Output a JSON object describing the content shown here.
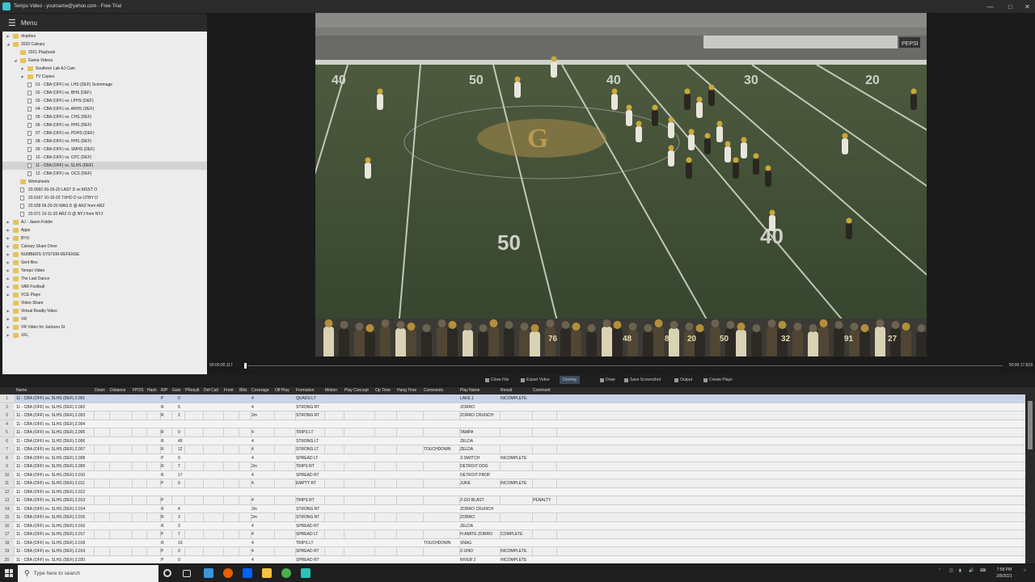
{
  "window": {
    "title": "Tempo Video - yourname@yahoo.com - Free Trial"
  },
  "menu": {
    "label": "Menu"
  },
  "tree": [
    {
      "label": "dropbox",
      "depth": 0,
      "icon": "folder",
      "arrow": "right"
    },
    {
      "label": "2020 Calvary",
      "depth": 0,
      "icon": "folder",
      "arrow": "down"
    },
    {
      "label": "2021 Playbook",
      "depth": 1,
      "icon": "folder",
      "arrow": ""
    },
    {
      "label": "Game Videos",
      "depth": 1,
      "icon": "folder",
      "arrow": "down"
    },
    {
      "label": "Southern Lab AJ Cam",
      "depth": 2,
      "icon": "folder",
      "arrow": "right"
    },
    {
      "label": "TV Copies",
      "depth": 2,
      "icon": "folder",
      "arrow": "right"
    },
    {
      "label": "01 - CBA (OFF) vs. LHS (DEF) Scrimmage",
      "depth": 2,
      "icon": "file",
      "arrow": ""
    },
    {
      "label": "02 - CBA (OFF) vs. BHS (DEF)",
      "depth": 2,
      "icon": "file",
      "arrow": ""
    },
    {
      "label": "03 - CBA (OFF) vs. LPHS (DEF)",
      "depth": 2,
      "icon": "file",
      "arrow": ""
    },
    {
      "label": "04 - CBA (OFF) vs. ARHS (DEF)",
      "depth": 2,
      "icon": "file",
      "arrow": ""
    },
    {
      "label": "05 - CBA (OFF) vs. CHS (DEF)",
      "depth": 2,
      "icon": "file",
      "arrow": ""
    },
    {
      "label": "06 - CBA (OFF) vs. HHS (DEF)",
      "depth": 2,
      "icon": "file",
      "arrow": ""
    },
    {
      "label": "07 - CBA (OFF) vs. PDHS (DEF)",
      "depth": 2,
      "icon": "file",
      "arrow": ""
    },
    {
      "label": "08 - CBA (OFF) vs. HHS (DEF)",
      "depth": 2,
      "icon": "file",
      "arrow": ""
    },
    {
      "label": "09 - CBA (OFF) vs. SMHS (DEF)",
      "depth": 2,
      "icon": "file",
      "arrow": ""
    },
    {
      "label": "10 - CBA (OFF) vs. CPC (DEF)",
      "depth": 2,
      "icon": "file",
      "arrow": ""
    },
    {
      "label": "11 - CBA (OFF) vs. SLHS (DEF)",
      "depth": 2,
      "icon": "file",
      "arrow": "",
      "selected": true
    },
    {
      "label": "12 - CBA (OFF) vs. OCS (DEF)",
      "depth": 2,
      "icon": "file",
      "arrow": ""
    },
    {
      "label": "Worksheets",
      "depth": 1,
      "icon": "folder",
      "arrow": ""
    },
    {
      "label": "20.0092 09-26-20 LAST D vs MSST O",
      "depth": 1,
      "icon": "file",
      "arrow": ""
    },
    {
      "label": "20.0167 10-16-20 TXHO D vs UTBY O",
      "depth": 1,
      "icon": "file",
      "arrow": ""
    },
    {
      "label": "20.028 09-20-20 WAS D @ ARZ from ARZ",
      "depth": 1,
      "icon": "file",
      "arrow": ""
    },
    {
      "label": "20.071 10-11-20 ARZ O @ NYJ from NYJ",
      "depth": 1,
      "icon": "file",
      "arrow": ""
    },
    {
      "label": "AJ - Jason Folder",
      "depth": 0,
      "icon": "folder",
      "arrow": "right"
    },
    {
      "label": "Apps",
      "depth": 0,
      "icon": "folder",
      "arrow": "right"
    },
    {
      "label": "BYU",
      "depth": 0,
      "icon": "folder",
      "arrow": "right"
    },
    {
      "label": "Calvary Share Drive",
      "depth": 0,
      "icon": "folder",
      "arrow": "right"
    },
    {
      "label": "NUMBERS SYSTEM-DEFENSE",
      "depth": 0,
      "icon": "folder",
      "arrow": "right"
    },
    {
      "label": "Sent files",
      "depth": 0,
      "icon": "folder",
      "arrow": "right"
    },
    {
      "label": "Tempo Video",
      "depth": 0,
      "icon": "folder",
      "arrow": "right"
    },
    {
      "label": "The Last Dance",
      "depth": 0,
      "icon": "folder",
      "arrow": "right"
    },
    {
      "label": "VAR Football",
      "depth": 0,
      "icon": "folder",
      "arrow": "right"
    },
    {
      "label": "VCE Plays",
      "depth": 0,
      "icon": "folder",
      "arrow": "right"
    },
    {
      "label": "Video Share",
      "depth": 0,
      "icon": "folder",
      "arrow": ""
    },
    {
      "label": "Virtual Reality Video",
      "depth": 0,
      "icon": "folder",
      "arrow": "right"
    },
    {
      "label": "VR",
      "depth": 0,
      "icon": "folder",
      "arrow": "right"
    },
    {
      "label": "VR Video for Jackson St",
      "depth": 0,
      "icon": "folder",
      "arrow": "right"
    },
    {
      "label": "XFL",
      "depth": 0,
      "icon": "folder",
      "arrow": "right"
    }
  ],
  "video": {
    "time_current": "00:00:00.117",
    "time_total": "00:00:17.818",
    "yard_labels": [
      "40",
      "50",
      "40",
      "30",
      "20",
      "50",
      "40"
    ],
    "jersey_numbers": [
      "76",
      "48",
      "87",
      "20",
      "50",
      "32",
      "91",
      "27"
    ],
    "scoreboard_text": "PEPSI"
  },
  "toolbar": {
    "close_file": "Close File",
    "export_video": "Export Video",
    "overlay": "Overlay",
    "draw": "Draw",
    "save_screenshot": "Save Screenshot",
    "output": "Output",
    "create_plays": "Create Plays"
  },
  "grid": {
    "columns": [
      "Name",
      "Down",
      "Distance",
      "FPOS",
      "Hash",
      "R/P",
      "Gain",
      "PResult",
      "Def Call",
      "Front",
      "Blitz",
      "Coverage",
      "Off Play",
      "Formation",
      "Motion",
      "Play Concept",
      "Op Time",
      "Hang Time",
      "Comments",
      "Play Name",
      "Result",
      "Comment"
    ],
    "rows": [
      {
        "n": "1",
        "name": "11 - CBA (OFF) vs. SLHS (DEF).2.001",
        "rp": "P",
        "gain": "0",
        "cov": "4",
        "form": "QUADS LT",
        "cmts": "",
        "play": "LAKE 1",
        "result": "INCOMPLETE",
        "comment": ""
      },
      {
        "n": "2",
        "name": "11 - CBA (OFF) vs. SLHS (DEF).2.002",
        "rp": "R",
        "gain": "5",
        "cov": "4",
        "form": "STRONG RT",
        "cmts": "",
        "play": "ZORRO",
        "result": "",
        "comment": ""
      },
      {
        "n": "3",
        "name": "11 - CBA (OFF) vs. SLHS (DEF).2.003",
        "rp": "R",
        "gain": "2",
        "cov": "2m",
        "form": "STRONG RT",
        "cmts": "",
        "play": "ZORRO CRUNCH",
        "result": "",
        "comment": ""
      },
      {
        "n": "4",
        "name": "11 - CBA (OFF) vs. SLHS (DEF).2.004",
        "rp": "",
        "gain": "",
        "cov": "",
        "form": "",
        "cmts": "",
        "play": "",
        "result": "",
        "comment": ""
      },
      {
        "n": "5",
        "name": "11 - CBA (OFF) vs. SLHS (DEF).2.005",
        "rp": "R",
        "gain": "0",
        "cov": "4",
        "form": "TRIPS LT",
        "cmts": "",
        "play": "TAMPA",
        "result": "",
        "comment": ""
      },
      {
        "n": "6",
        "name": "11 - CBA (OFF) vs. SLHS (DEF).2.006",
        "rp": "R",
        "gain": "49",
        "cov": "4",
        "form": "STRONG LT",
        "cmts": "",
        "play": "ZELDA",
        "result": "",
        "comment": ""
      },
      {
        "n": "7",
        "name": "11 - CBA (OFF) vs. SLHS (DEF).2.007",
        "rp": "R",
        "gain": "12",
        "cov": "4",
        "form": "STRONG LT",
        "cmts": "TOUCHDOWN",
        "play": "ZELDA",
        "result": "",
        "comment": ""
      },
      {
        "n": "8",
        "name": "11 - CBA (OFF) vs. SLHS (DEF).2.008",
        "rp": "P",
        "gain": "0",
        "cov": "4",
        "form": "SPREAD LT",
        "cmts": "",
        "play": "Z-SWITCH",
        "result": "INCOMPLETE",
        "comment": ""
      },
      {
        "n": "9",
        "name": "11 - CBA (OFF) vs. SLHS (DEF).2.009",
        "rp": "R",
        "gain": "7",
        "cov": "2m",
        "form": "TRIPS RT",
        "cmts": "",
        "play": "DETROIT DOG",
        "result": "",
        "comment": ""
      },
      {
        "n": "10",
        "name": "11 - CBA (OFF) vs. SLHS (DEF).2.010",
        "rp": "R",
        "gain": "17",
        "cov": "4",
        "form": "SPREAD RT",
        "cmts": "",
        "play": "DETROIT PROP",
        "result": "",
        "comment": ""
      },
      {
        "n": "11",
        "name": "11 - CBA (OFF) vs. SLHS (DEF).2.011",
        "rp": "P",
        "gain": "0",
        "cov": "4",
        "form": "EMPTY RT",
        "cmts": "",
        "play": "JUKE",
        "result": "INCOMPLETE",
        "comment": ""
      },
      {
        "n": "12",
        "name": "11 - CBA (OFF) vs. SLHS (DEF).2.012",
        "rp": "",
        "gain": "",
        "cov": "",
        "form": "",
        "cmts": "",
        "play": "",
        "result": "",
        "comment": ""
      },
      {
        "n": "13",
        "name": "11 - CBA (OFF) vs. SLHS (DEF).2.013",
        "rp": "P",
        "gain": "",
        "cov": "4",
        "form": "TRIPS RT",
        "cmts": "",
        "play": "Z-GO BLAST",
        "result": "",
        "comment": "PENALTY"
      },
      {
        "n": "14",
        "name": "11 - CBA (OFF) vs. SLHS (DEF).2.014",
        "rp": "R",
        "gain": "4",
        "cov": "2m",
        "form": "STRONG RT",
        "cmts": "",
        "play": "ZORRO CRUNCH",
        "result": "",
        "comment": ""
      },
      {
        "n": "15",
        "name": "11 - CBA (OFF) vs. SLHS (DEF).2.015",
        "rp": "R",
        "gain": "3",
        "cov": "2m",
        "form": "STRONG RT",
        "cmts": "",
        "play": "ZORRO",
        "result": "",
        "comment": ""
      },
      {
        "n": "16",
        "name": "11 - CBA (OFF) vs. SLHS (DEF).2.016",
        "rp": "R",
        "gain": "3",
        "cov": "4",
        "form": "SPREAD RT",
        "cmts": "",
        "play": "ZELDA",
        "result": "",
        "comment": ""
      },
      {
        "n": "17",
        "name": "11 - CBA (OFF) vs. SLHS (DEF).2.017",
        "rp": "P",
        "gain": "7",
        "cov": "4",
        "form": "SPREAD LT",
        "cmts": "",
        "play": "H-AMITE ZORRO",
        "result": "COMPLETE",
        "comment": ""
      },
      {
        "n": "18",
        "name": "11 - CBA (OFF) vs. SLHS (DEF).2.018",
        "rp": "R",
        "gain": "10",
        "cov": "4",
        "form": "TRIPS LT",
        "cmts": "TOUCHDOWN",
        "play": "SNAG",
        "result": "",
        "comment": ""
      },
      {
        "n": "19",
        "name": "11 - CBA (OFF) vs. SLHS (DEF).2.019",
        "rp": "P",
        "gain": "0",
        "cov": "4",
        "form": "SPREAD RT",
        "cmts": "",
        "play": "Z-UNO",
        "result": "INCOMPLETE",
        "comment": ""
      },
      {
        "n": "20",
        "name": "11 - CBA (OFF) vs. SLHS (DEF).2.020",
        "rp": "P",
        "gain": "0",
        "cov": "4",
        "form": "SPREAD RT",
        "cmts": "",
        "play": "RIVER 2",
        "result": "INCOMPLETE",
        "comment": ""
      }
    ]
  },
  "taskbar": {
    "search_placeholder": "Type here to search",
    "time": "7:58 PM",
    "date": "2/8/2021",
    "colors": {
      "edge": "#3a96dd",
      "firefox": "#e66000",
      "dropbox": "#0061fe",
      "explorer": "#f6c342",
      "chrome": "#4caf50",
      "tempo": "#27c4b5"
    }
  }
}
